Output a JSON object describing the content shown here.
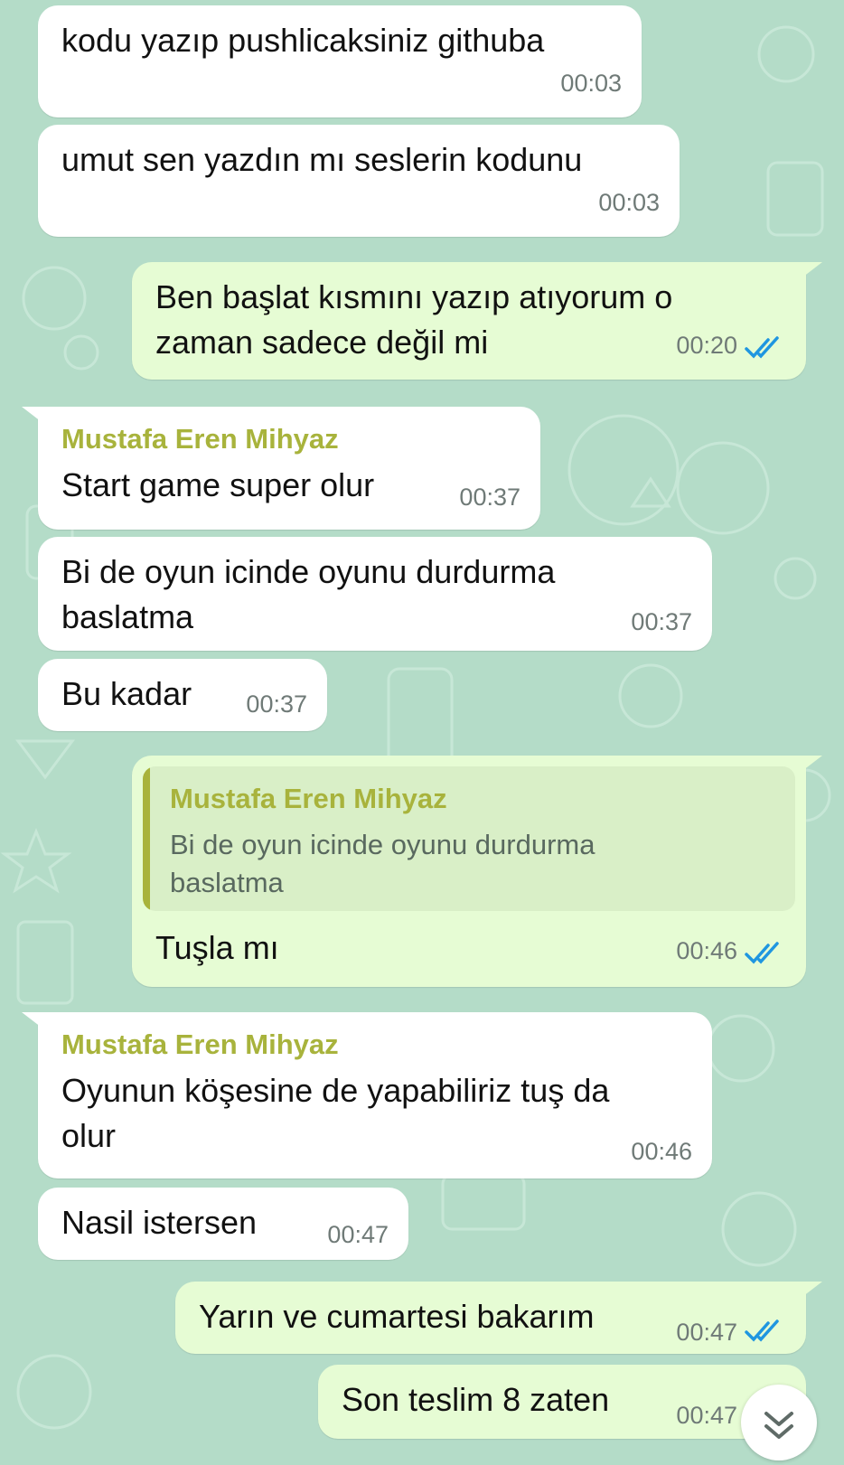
{
  "messages": [
    {
      "text": "kodu yazıp pushlicaksiniz githuba",
      "time": "00:03"
    },
    {
      "text": "umut sen yazdın mı seslerin kodunu",
      "time": "00:03"
    },
    {
      "text": "Ben başlat kısmını yazıp atıyorum o\nzaman sadece değil mi",
      "time": "00:20"
    },
    {
      "sender": "Mustafa Eren Mihyaz",
      "text": "Start game super olur",
      "time": "00:37"
    },
    {
      "text": "Bi de oyun icinde oyunu durdurma\nbaslatma",
      "time": "00:37"
    },
    {
      "text": "Bu kadar",
      "time": "00:37"
    },
    {
      "quote": {
        "sender": "Mustafa Eren Mihyaz",
        "text": "Bi de oyun icinde oyunu durdurma\nbaslatma"
      },
      "text": "Tuşla mı",
      "time": "00:46"
    },
    {
      "sender": "Mustafa Eren Mihyaz",
      "text": "Oyunun köşesine de yapabiliriz tuş da\nolur",
      "time": "00:46"
    },
    {
      "text": "Nasil istersen",
      "time": "00:47"
    },
    {
      "text": "Yarın ve cumartesi bakarım",
      "time": "00:47"
    },
    {
      "text": "Son teslim 8 zaten",
      "time": "00:47"
    }
  ],
  "colors": {
    "wallpaper": "#b4dcc8",
    "incoming_bubble": "#ffffff",
    "outgoing_bubble": "#e6fcd4",
    "sender_name": "#a8b33c",
    "read_tick": "#1f96e0"
  },
  "icons": {
    "read_receipt": "double-check-icon",
    "scroll_down": "double-chevron-down-icon"
  }
}
